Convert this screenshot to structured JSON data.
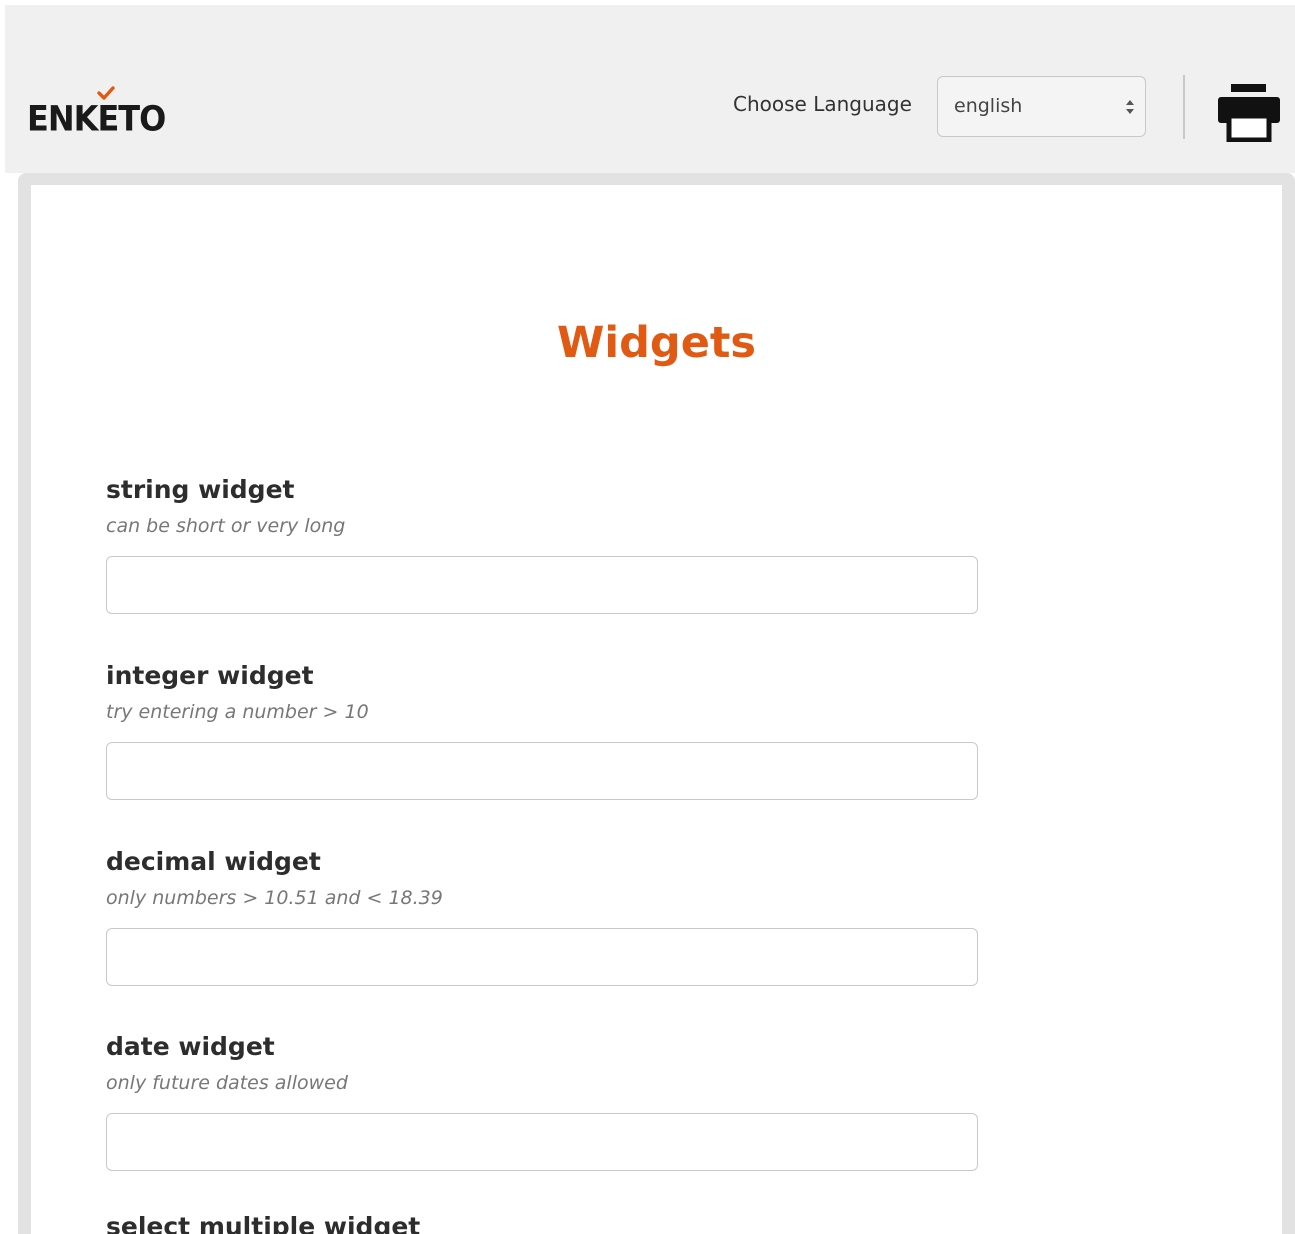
{
  "header": {
    "logo_text": "ENKETO",
    "language_label": "Choose Language",
    "language_selected": "english",
    "print_icon": "printer-icon",
    "colors": {
      "logo_check": "#e05a13",
      "header_bg": "#f0f0f0"
    }
  },
  "form": {
    "title": "Widgets",
    "title_color": "#e05a13",
    "questions": [
      {
        "label": "string widget",
        "hint": "can be short or very long",
        "value": ""
      },
      {
        "label": "integer widget",
        "hint": "try entering a number > 10",
        "value": ""
      },
      {
        "label": "decimal widget",
        "hint": "only numbers > 10.51 and < 18.39",
        "value": ""
      },
      {
        "label": "date widget",
        "hint": "only future dates allowed",
        "value": ""
      }
    ],
    "next_question_label": "select multiple widget"
  }
}
